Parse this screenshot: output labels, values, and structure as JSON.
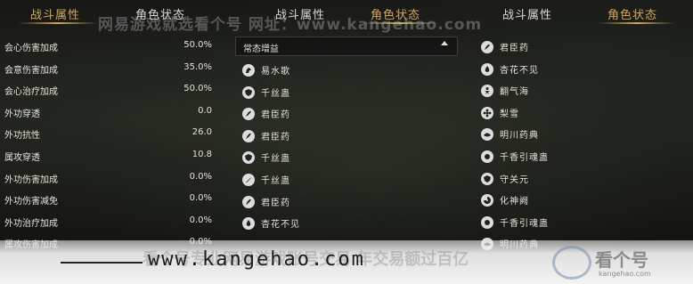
{
  "watermark": {
    "top_text": "网易游戏就选看个号  网址：www.kangehao.com",
    "banner_url": "www.kangehao.com",
    "banner_ghost": "看个号专业网易游戏账号交易 年交易额过百亿",
    "brand_name": "看个号",
    "brand_sub": "kangehao.com"
  },
  "panel1": {
    "tab_active": "战斗属性",
    "tab_inactive": "角色状态",
    "stats": [
      {
        "name": "会心伤害加成",
        "value": "50.0%"
      },
      {
        "name": "会意伤害加成",
        "value": "35.0%"
      },
      {
        "name": "会心治疗加成",
        "value": "50.0%"
      },
      {
        "name": "外功穿透",
        "value": "0.0"
      },
      {
        "name": "外功抗性",
        "value": "26.0"
      },
      {
        "name": "属攻穿透",
        "value": "10.8"
      },
      {
        "name": "外功伤害加成",
        "value": "0.0%"
      },
      {
        "name": "外功伤害减免",
        "value": "0.0%"
      },
      {
        "name": "外功治疗加成",
        "value": "0.0%"
      },
      {
        "name": "属攻伤害加成",
        "value": "0.0%"
      }
    ]
  },
  "panel2": {
    "tab_inactive": "战斗属性",
    "tab_active": "角色状态",
    "dropdown": "常态增益",
    "buffs": [
      {
        "label": "易水歌",
        "icon": "horse-icon"
      },
      {
        "label": "千丝蛊",
        "icon": "shield-icon"
      },
      {
        "label": "君臣药",
        "icon": "herb-icon"
      },
      {
        "label": "君臣药",
        "icon": "herb-icon"
      },
      {
        "label": "千丝蛊",
        "icon": "shield-icon"
      },
      {
        "label": "千丝蛊",
        "icon": "blade-icon"
      },
      {
        "label": "君臣药",
        "icon": "herb-icon"
      },
      {
        "label": "杏花不见",
        "icon": "flame-icon"
      }
    ]
  },
  "panel3": {
    "tab_inactive": "战斗属性",
    "tab_active": "角色状态",
    "buffs": [
      {
        "label": "君臣药",
        "icon": "herb-icon"
      },
      {
        "label": "杏花不见",
        "icon": "flame-icon"
      },
      {
        "label": "翻气海",
        "icon": "figure-icon"
      },
      {
        "label": "梨雪",
        "icon": "flower-icon"
      },
      {
        "label": "明川药典",
        "icon": "lotus-icon"
      },
      {
        "label": "千香引魂蛊",
        "icon": "orb-icon"
      },
      {
        "label": "守关元",
        "icon": "shield-icon"
      },
      {
        "label": "化神阙",
        "icon": "spin-icon"
      },
      {
        "label": "千香引魂蛊",
        "icon": "orb-icon"
      },
      {
        "label": "明川药典",
        "icon": "lotus-icon"
      }
    ]
  },
  "colors": {
    "accent": "#d1a75a",
    "text": "#e6e2d6",
    "background": "#121210"
  }
}
